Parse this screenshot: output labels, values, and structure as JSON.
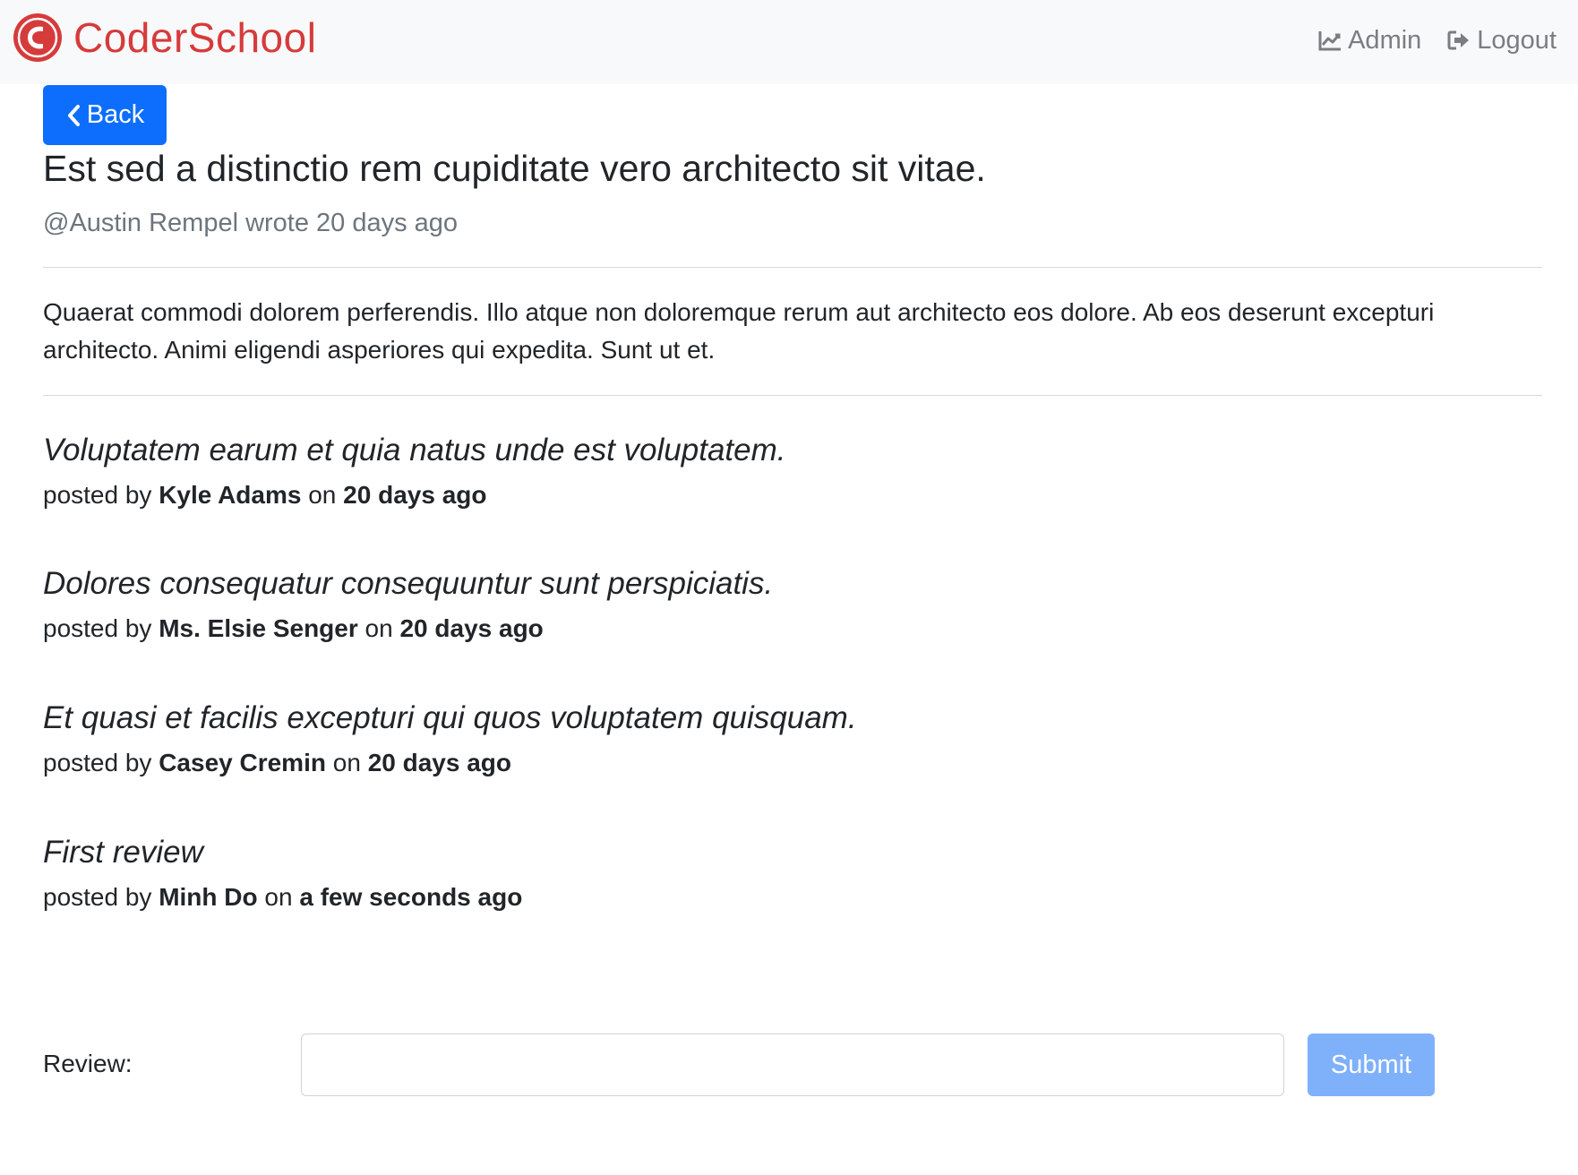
{
  "colors": {
    "brand": "#d63b3b",
    "primary": "#0d6efd",
    "primary_disabled": "#7fb1fb",
    "muted": "#6c757d",
    "navbar_bg": "#f8f9fa"
  },
  "navbar": {
    "brand_name": "CoderSchool",
    "brand_icon": "coderschool-logo-icon",
    "links": [
      {
        "label": "Admin",
        "icon": "chart-line-icon"
      },
      {
        "label": "Logout",
        "icon": "sign-out-icon"
      }
    ]
  },
  "back_button": {
    "label": "Back",
    "icon": "chevron-left-icon"
  },
  "post": {
    "title": "Est sed a distinctio rem cupiditate vero architecto sit vitae.",
    "meta": "@Austin Rempel wrote 20 days ago",
    "body": "Quaerat commodi dolorem perferendis. Illo atque non doloremque rerum aut architecto eos dolore. Ab eos deserunt excepturi architecto. Animi eligendi asperiores qui expedita. Sunt ut et."
  },
  "review_labels": {
    "posted_by": "posted by",
    "on": "on"
  },
  "reviews": [
    {
      "text": "Voluptatem earum et quia natus unde est voluptatem.",
      "author": "Kyle Adams",
      "time": "20 days ago"
    },
    {
      "text": "Dolores consequatur consequuntur sunt perspiciatis.",
      "author": "Ms. Elsie Senger",
      "time": "20 days ago"
    },
    {
      "text": "Et quasi et facilis excepturi qui quos voluptatem quisquam.",
      "author": "Casey Cremin",
      "time": "20 days ago"
    },
    {
      "text": "First review",
      "author": "Minh Do",
      "time": "a few seconds ago"
    }
  ],
  "review_form": {
    "label": "Review:",
    "value": "",
    "placeholder": "",
    "submit_label": "Submit",
    "submit_disabled": true
  }
}
